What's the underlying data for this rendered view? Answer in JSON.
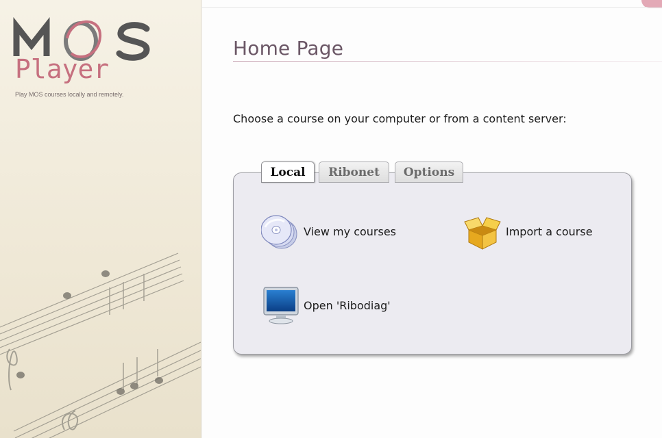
{
  "brand": {
    "logo_top": "MOS",
    "logo_bottom": "Player",
    "tagline": "Play MOS courses locally and remotely."
  },
  "page": {
    "title": "Home Page",
    "instruction": "Choose a course on your computer or from a content server:"
  },
  "tabs": [
    {
      "label": "Local",
      "active": true
    },
    {
      "label": "Ribonet",
      "active": false
    },
    {
      "label": "Options",
      "active": false
    }
  ],
  "actions": [
    {
      "label": "View my courses",
      "icon": "disc-stack-icon"
    },
    {
      "label": "Import a course",
      "icon": "open-box-icon"
    },
    {
      "label": "Open 'Ribodiag'",
      "icon": "monitor-icon"
    }
  ],
  "colors": {
    "accent": "#c6707f",
    "title": "#6b5766",
    "panel": "#ecebf1"
  }
}
